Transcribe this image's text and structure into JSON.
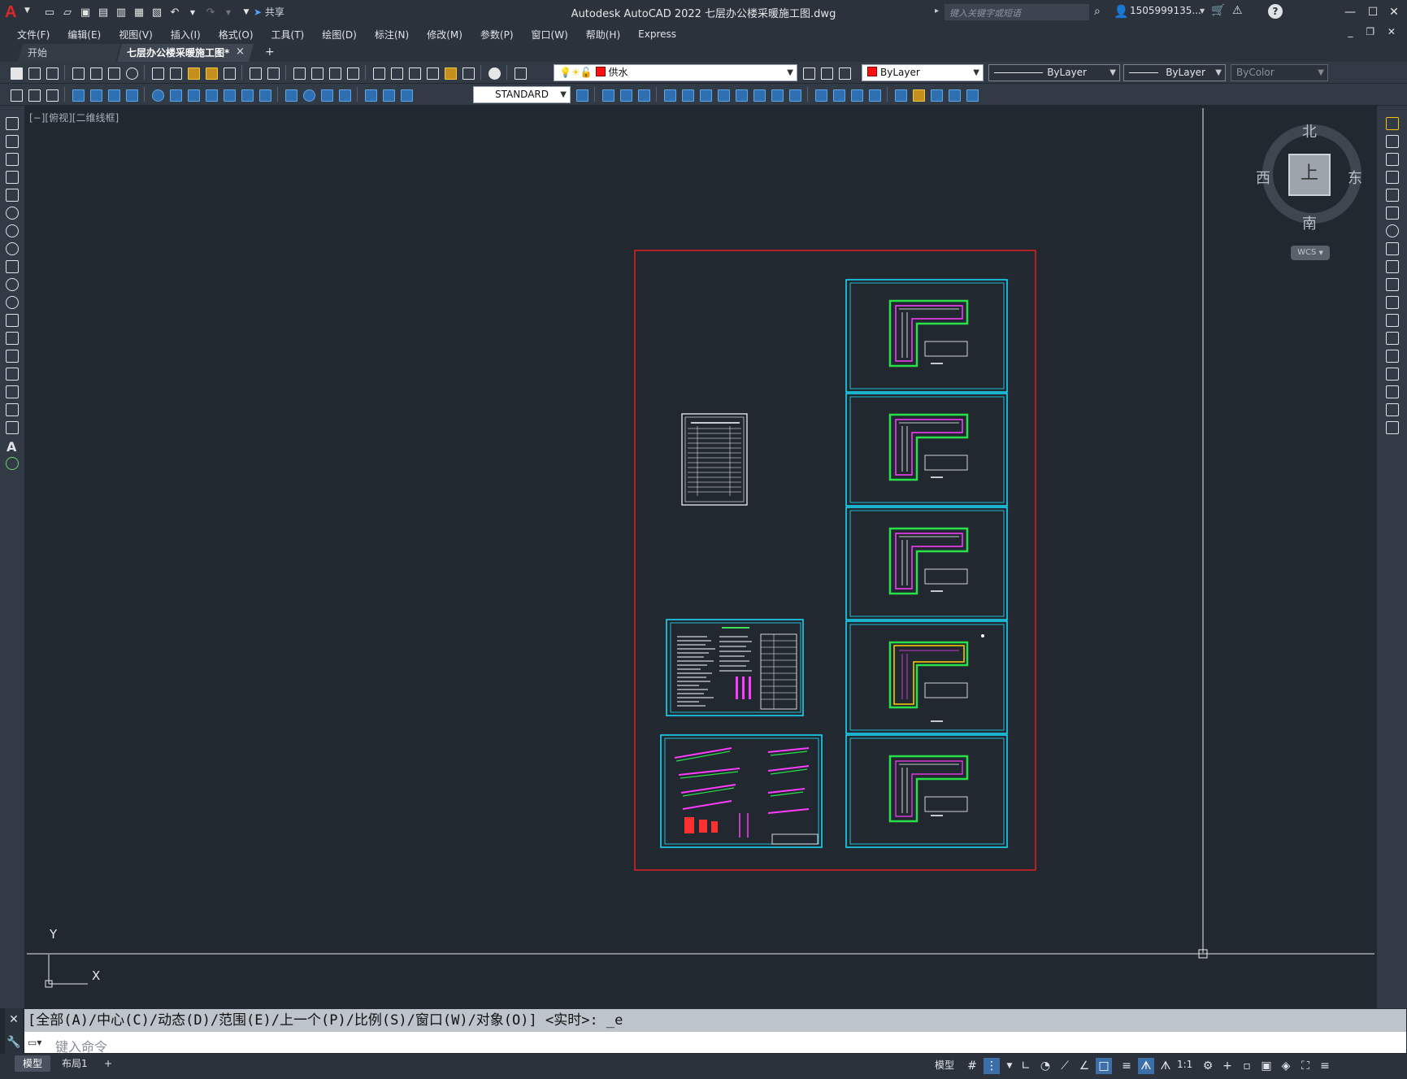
{
  "app": {
    "title": "Autodesk AutoCAD 2022    七层办公楼采暖施工图.dwg",
    "logo": "A",
    "share_label": "共享",
    "search_placeholder": "键入关键字或短语",
    "user": "1505999135...",
    "help_label": "?"
  },
  "menu": [
    "文件(F)",
    "编辑(E)",
    "视图(V)",
    "插入(I)",
    "格式(O)",
    "工具(T)",
    "绘图(D)",
    "标注(N)",
    "修改(M)",
    "参数(P)",
    "窗口(W)",
    "帮助(H)",
    "Express"
  ],
  "tabs": {
    "start": "开始",
    "drawing": "七层办公楼采暖施工图*",
    "close_glyph": "×",
    "add_glyph": "+"
  },
  "toolbar": {
    "layer": "供水",
    "layer_color": "#ff1010",
    "color": "ByLayer",
    "linetype": "ByLayer",
    "lineweight": "ByLayer",
    "plotstyle": "ByColor",
    "textstyle": "STANDARD"
  },
  "viewport": {
    "label": "[−][俯视][二维线框]"
  },
  "viewcube": {
    "north": "北",
    "south": "南",
    "east": "东",
    "west": "西",
    "face": "上",
    "wcs": "WCS"
  },
  "ucs": {
    "x": "X",
    "y": "Y"
  },
  "command": {
    "history": "[全部(A)/中心(C)/动态(D)/范围(E)/上一个(P)/比例(S)/窗口(W)/对象(O)] <实时>: _e",
    "placeholder": "键入命令"
  },
  "layouts": {
    "model": "模型",
    "layout1": "布局1",
    "add": "+"
  },
  "status": {
    "model": "模型",
    "scale": "1:1"
  },
  "colors": {
    "frame_red": "#ff2020",
    "frame_cyan": "#19e0ff",
    "plan_green": "#29e04a",
    "plan_magenta": "#ff3cff"
  }
}
